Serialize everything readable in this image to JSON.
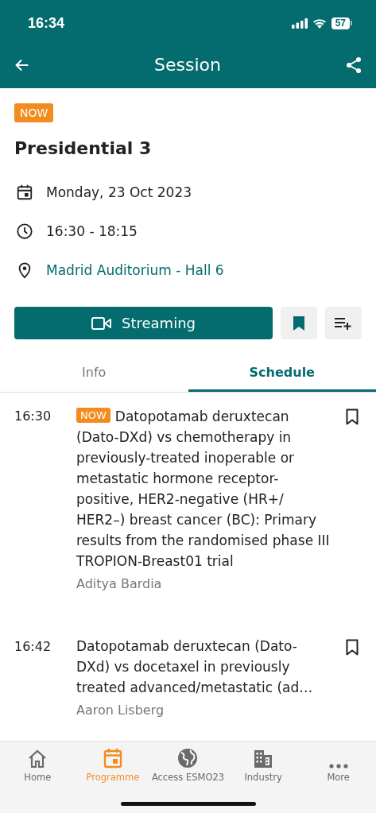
{
  "status_bar": {
    "time": "16:34",
    "battery": "57"
  },
  "header": {
    "title": "Session"
  },
  "session": {
    "badge": "NOW",
    "title": "Presidential 3",
    "date": "Monday, 23 Oct 2023",
    "time": "16:30 - 18:15",
    "location": "Madrid Auditorium - Hall 6"
  },
  "actions": {
    "streaming": "Streaming"
  },
  "tabs": [
    {
      "label": "Info",
      "selected": false
    },
    {
      "label": "Schedule",
      "selected": true
    }
  ],
  "schedule": [
    {
      "time": "16:30",
      "now": true,
      "badge": "NOW",
      "title": "Datopotamab deruxtecan (Dato-DXd) vs chemotherapy in previously-treated inoperable or metastatic hormone receptor-positive, HER2-negative (HR+/ HER2–) breast cancer (BC): Primary results from the randomised phase III TROPION-Breast01 trial",
      "speaker": "Aditya Bardia"
    },
    {
      "time": "16:42",
      "now": false,
      "title": "Datopotamab deruxtecan (Dato-DXd) vs docetaxel in previously treated advanced/metastatic (ad…",
      "speaker": "Aaron Lisberg"
    }
  ],
  "bottom_nav": [
    {
      "label": "Home",
      "kind": "home",
      "selected": false
    },
    {
      "label": "Programme",
      "kind": "calendar",
      "selected": true
    },
    {
      "label": "Access ESMO23",
      "kind": "globe",
      "selected": false
    },
    {
      "label": "Industry",
      "kind": "building",
      "selected": false
    },
    {
      "label": "More",
      "kind": "more",
      "selected": false
    }
  ]
}
